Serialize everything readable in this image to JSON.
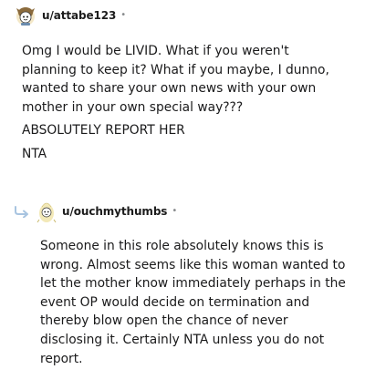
{
  "comments": [
    {
      "username": "u/attabe123",
      "separator": "•",
      "avatar_icon": "snoo-avatar-icon",
      "paragraphs": [
        "Omg I would be LIVID. What if you weren't planning to keep it? What if you maybe, I dunno, wanted to share your own news with your own mother in your own special way???",
        "ABSOLUTELY REPORT HER",
        "NTA"
      ]
    },
    {
      "username": "u/ouchmythumbs",
      "separator": "•",
      "avatar_icon": "snoo-avatar-icon",
      "reply_icon": "reply-arrow-icon",
      "paragraphs": [
        "Someone in this role absolutely knows this is wrong. Almost seems like this woman wanted to let the mother know immediately perhaps in the event OP would decide on termination and thereby blow open the chance of never disclosing it. Certainly NTA unless you do not report."
      ]
    }
  ],
  "colors": {
    "text": "#1a1a1b",
    "meta": "#878a8c",
    "reply_arrow": "#a8c4e0"
  }
}
